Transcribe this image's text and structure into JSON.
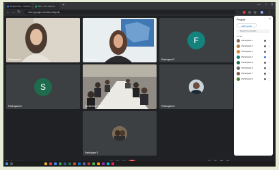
{
  "browser": {
    "tabs": [
      "Google Meet - meeting",
      "Meet - abc-defg-hij"
    ],
    "new_tab": "+",
    "address": "meet.google.com/abc-defg-hij",
    "controls": [
      "—",
      "□",
      "✕"
    ]
  },
  "meeting": {
    "tiles": [
      {
        "name": "Participant 1",
        "kind": "camera-woman-hair"
      },
      {
        "name": "Participant 2",
        "kind": "camera-woman-map"
      },
      {
        "name": "Participant F",
        "kind": "avatar",
        "initial": "F",
        "color": "#14827d"
      },
      {
        "name": "Participant S",
        "kind": "avatar",
        "initial": "S",
        "color": "#1f6b4e"
      },
      {
        "name": "Conference Room",
        "kind": "camera-room"
      },
      {
        "name": "Participant 6",
        "kind": "photo"
      },
      {
        "name": "Participant 7",
        "kind": "photo-center"
      }
    ],
    "bottom_text": "Meeting details",
    "end_call_icon": "phone-hangup-icon"
  },
  "people_panel": {
    "title": "People",
    "add_label": "Add people",
    "search_placeholder": "Search for people",
    "section_label": "In call",
    "participants": [
      {
        "name": "Participant 1",
        "color": "#8e6d5a"
      },
      {
        "name": "Participant 2",
        "color": "#b07f3a"
      },
      {
        "name": "Participant 3",
        "color": "#d28b34"
      },
      {
        "name": "Participant F",
        "color": "#14827d"
      },
      {
        "name": "Participant S",
        "color": "#1f6b4e"
      },
      {
        "name": "Participant 6",
        "color": "#6a6a6a"
      },
      {
        "name": "Participant 7",
        "color": "#7a5a48"
      },
      {
        "name": "Participant 8",
        "color": "#4b7f3a"
      }
    ]
  },
  "taskbar": {
    "time": "",
    "date": ""
  }
}
